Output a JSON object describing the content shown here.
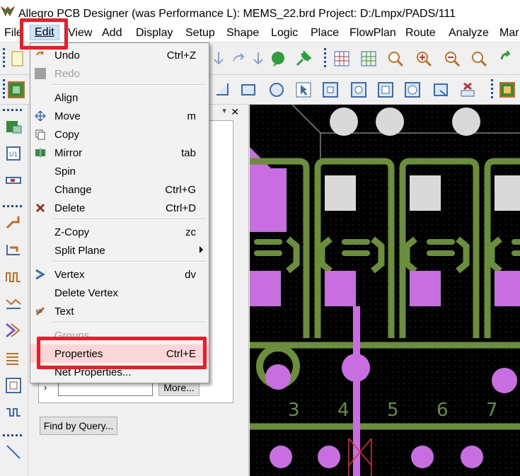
{
  "window": {
    "title": "Allegro PCB Designer (was Performance L): MEMS_22.brd  Project: D:/Lmpx/PADS/111"
  },
  "menubar": {
    "items": [
      {
        "key": "File",
        "label": "File"
      },
      {
        "key": "Edit",
        "label": "Edit"
      },
      {
        "key": "View",
        "label": "View"
      },
      {
        "key": "Add",
        "label": "Add"
      },
      {
        "key": "Display",
        "label": "Display"
      },
      {
        "key": "Setup",
        "label": "Setup"
      },
      {
        "key": "Shape",
        "label": "Shape"
      },
      {
        "key": "Logic",
        "label": "Logic"
      },
      {
        "key": "Place",
        "label": "Place"
      },
      {
        "key": "FlowPlan",
        "label": "FlowPlan"
      },
      {
        "key": "Route",
        "label": "Route"
      },
      {
        "key": "Analyze",
        "label": "Analyze"
      },
      {
        "key": "Manufacture",
        "label": "Mar"
      }
    ]
  },
  "edit_menu": {
    "items": [
      {
        "label": "Undo",
        "shortcut": "Ctrl+Z",
        "disabled": false
      },
      {
        "label": "Redo",
        "shortcut": "",
        "disabled": true
      },
      {
        "label": "Align",
        "shortcut": "",
        "disabled": false
      },
      {
        "label": "Move",
        "shortcut": "m",
        "disabled": false
      },
      {
        "label": "Copy",
        "shortcut": "",
        "disabled": false
      },
      {
        "label": "Mirror",
        "shortcut": "tab",
        "disabled": false
      },
      {
        "label": "Spin",
        "shortcut": "",
        "disabled": false
      },
      {
        "label": "Change",
        "shortcut": "Ctrl+G",
        "disabled": false
      },
      {
        "label": "Delete",
        "shortcut": "Ctrl+D",
        "disabled": false
      },
      {
        "label": "Z-Copy",
        "shortcut": "zc",
        "disabled": false
      },
      {
        "label": "Split Plane",
        "shortcut": "",
        "disabled": false
      },
      {
        "label": "Vertex",
        "shortcut": "dv",
        "disabled": false
      },
      {
        "label": "Delete Vertex",
        "shortcut": "",
        "disabled": false
      },
      {
        "label": "Text",
        "shortcut": "",
        "disabled": false
      },
      {
        "label": "Groups",
        "shortcut": "",
        "disabled": true
      },
      {
        "label": "Properties",
        "shortcut": "Ctrl+E",
        "disabled": false,
        "highlighted": true
      },
      {
        "label": "Net Properties...",
        "shortcut": "",
        "disabled": false
      }
    ]
  },
  "find_panel": {
    "more_button": "More...",
    "find_by_query_button": "Find by Query...",
    "name_input_value": ""
  },
  "canvas": {
    "pin_numbers": [
      "3",
      "4",
      "5",
      "6",
      "7"
    ],
    "colors": {
      "background": "#000000",
      "trace": "#6b8e3a",
      "pad": "#c86ee0",
      "pad_white": "#d9d9d9"
    }
  },
  "colors": {
    "menu_highlight": "#fbd6d7",
    "annotation_red": "#ee1c25"
  }
}
